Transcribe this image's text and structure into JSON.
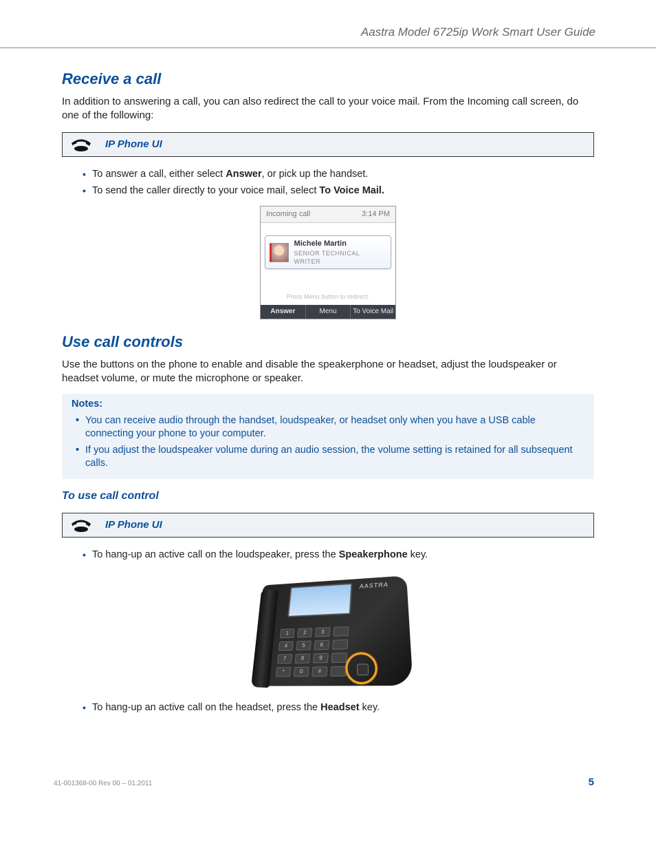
{
  "header": {
    "title": "Aastra Model 6725ip Work Smart User Guide"
  },
  "sec1": {
    "heading": "Receive a call",
    "intro": "In addition to answering a call, you can also redirect the call to your voice mail. From the Incoming call screen, do one of the following:",
    "band": "IP Phone UI",
    "b1a": "To answer a call, either select ",
    "b1b": "Answer",
    "b1c": ", or pick up the handset.",
    "b2a": "To send the caller directly to your voice mail, select ",
    "b2b": "To Voice Mail."
  },
  "screen": {
    "title": "Incoming call",
    "time": "3:14 PM",
    "name": "Michele Martin",
    "role": "SENIOR TECHNICAL WRITER",
    "hint": "Press Menu button to redirect.",
    "btn1": "Answer",
    "btn2": "Menu",
    "btn3": "To Voice Mail"
  },
  "sec2": {
    "heading": "Use call controls",
    "intro": "Use the buttons on the phone to enable and disable the speakerphone or headset, adjust the loudspeaker or headset volume, or mute the microphone or speaker.",
    "notes_title": "Notes:",
    "note1": "You can receive audio through the handset, loudspeaker, or headset only when you have a USB cable connecting your phone to your computer.",
    "note2": "If you adjust the loudspeaker volume during an audio session, the volume setting is retained for all subsequent calls.",
    "sub": "To use call control",
    "band": "IP Phone UI",
    "b1a": "To hang-up an active call on the loudspeaker, press the ",
    "b1b": "Speakerphone",
    "b1c": " key.",
    "b2a": "To hang-up an active call on the headset, press the ",
    "b2b": "Headset",
    "b2c": " key."
  },
  "photo": {
    "brand": "AASTRA"
  },
  "footer": {
    "rev": "41-001368-00 Rev 00  – 01.2011",
    "page": "5"
  }
}
